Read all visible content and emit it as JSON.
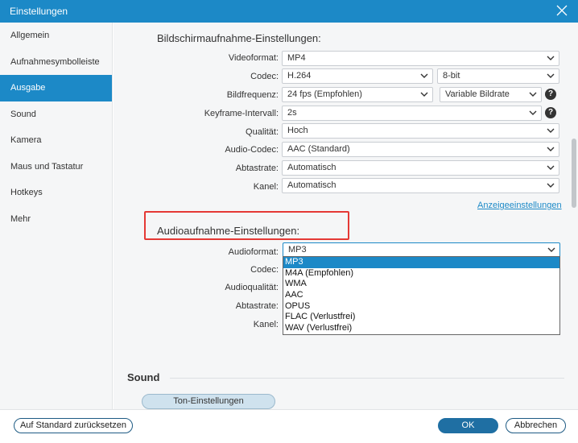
{
  "window": {
    "title": "Einstellungen"
  },
  "sidebar": {
    "items": [
      {
        "label": "Allgemein"
      },
      {
        "label": "Aufnahmesymbolleiste"
      },
      {
        "label": "Ausgabe",
        "active": true
      },
      {
        "label": "Sound"
      },
      {
        "label": "Kamera"
      },
      {
        "label": "Maus und Tastatur"
      },
      {
        "label": "Hotkeys"
      },
      {
        "label": "Mehr"
      }
    ]
  },
  "screen": {
    "title": "Bildschirmaufnahme-Einstellungen:",
    "videoformat": {
      "label": "Videoformat:",
      "value": "MP4"
    },
    "codec": {
      "label": "Codec:",
      "value": "H.264",
      "bitdepth": "8-bit"
    },
    "framerate": {
      "label": "Bildfrequenz:",
      "value": "24 fps (Empfohlen)",
      "bitrate": "Variable Bildrate"
    },
    "keyframe": {
      "label": "Keyframe-Intervall:",
      "value": "2s"
    },
    "quality": {
      "label": "Qualität:",
      "value": "Hoch"
    },
    "audiocodec": {
      "label": "Audio-Codec:",
      "value": "AAC (Standard)"
    },
    "samplerate": {
      "label": "Abtastrate:",
      "value": "Automatisch"
    },
    "channel": {
      "label": "Kanel:",
      "value": "Automatisch"
    },
    "display_link": "Anzeigeeinstellungen",
    "help_glyph": "?"
  },
  "audio": {
    "title": "Audioaufnahme-Einstellungen:",
    "format": {
      "label": "Audioformat:",
      "value": "MP3"
    },
    "codec": {
      "label": "Codec:"
    },
    "quality": {
      "label": "Audioqualität:"
    },
    "samplerate": {
      "label": "Abtastrate:"
    },
    "channel": {
      "label": "Kanel:"
    },
    "dropdown_options": [
      "MP3",
      "M4A (Empfohlen)",
      "WMA",
      "AAC",
      "OPUS",
      "FLAC (Verlustfrei)",
      "WAV (Verlustfrei)"
    ],
    "selected_option": "MP3"
  },
  "sound": {
    "title": "Sound",
    "settings_button": "Ton-Einstellungen"
  },
  "footer": {
    "reset_button": "Auf Standard zurücksetzen",
    "ok_button": "OK",
    "cancel_button": "Abbrechen"
  },
  "colors": {
    "accent": "#1c89c7",
    "highlight": "#e53935"
  },
  "icons": {
    "close": "close-icon",
    "chevron": "chevron-down-icon",
    "help": "help-icon"
  }
}
